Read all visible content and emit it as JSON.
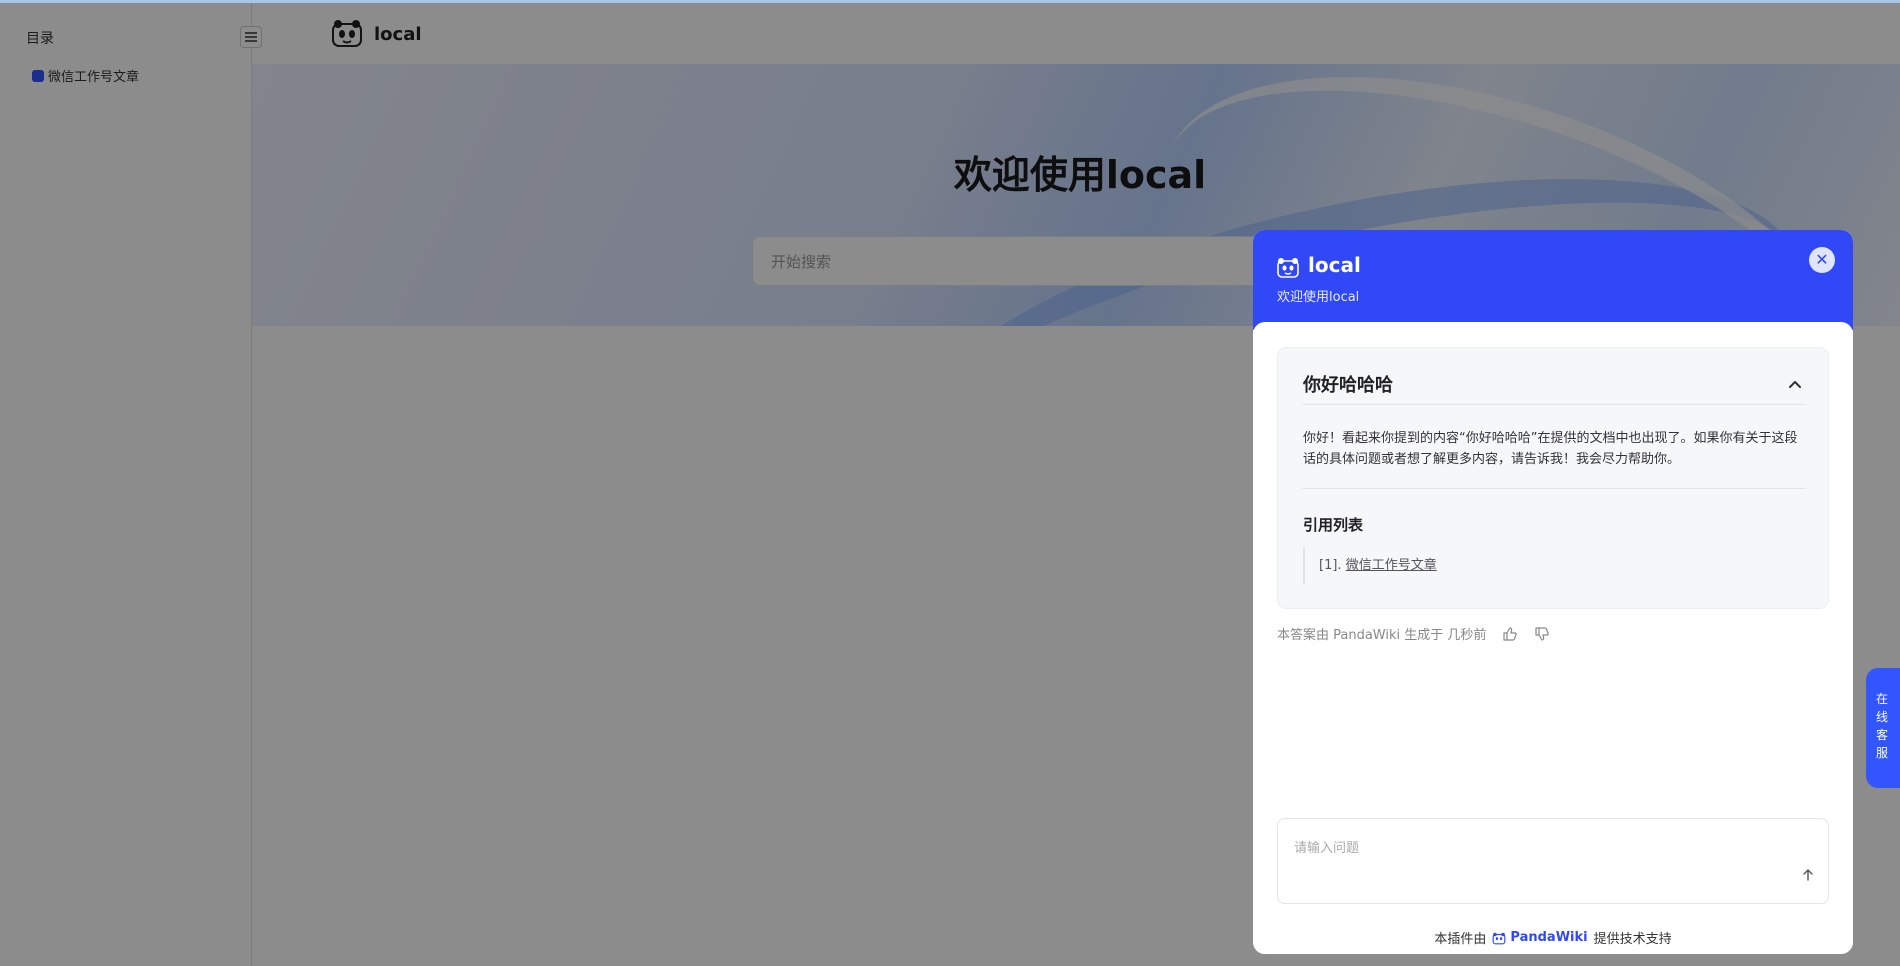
{
  "background": {
    "sidebar_title": "目录",
    "sidebar_items": [
      "微信工作号文章"
    ],
    "site_name": "local",
    "hero_title": "欢迎使用local",
    "search_placeholder": "开始搜索"
  },
  "side_tab": {
    "label": "在线客服"
  },
  "widget": {
    "name": "local",
    "welcome": "欢迎使用local",
    "question": "你好哈哈哈",
    "answer": "你好！看起来你提到的内容“你好哈哈哈”在提供的文档中也出现了。如果你有关于这段话的具体问题或者想了解更多内容，请告诉我！我会尽力帮助你。",
    "references_title": "引用列表",
    "references": [
      {
        "index": "[1].",
        "title": "微信工作号文章"
      }
    ],
    "meta_text": "本答案由 PandaWiki 生成于 几秒前",
    "input_placeholder": "请输入问题",
    "footer_prefix": "本插件由",
    "footer_brand": "PandaWiki",
    "footer_suffix": "提供技术支持",
    "colors": {
      "header": "#3048f5",
      "brand": "#3155ff"
    }
  }
}
